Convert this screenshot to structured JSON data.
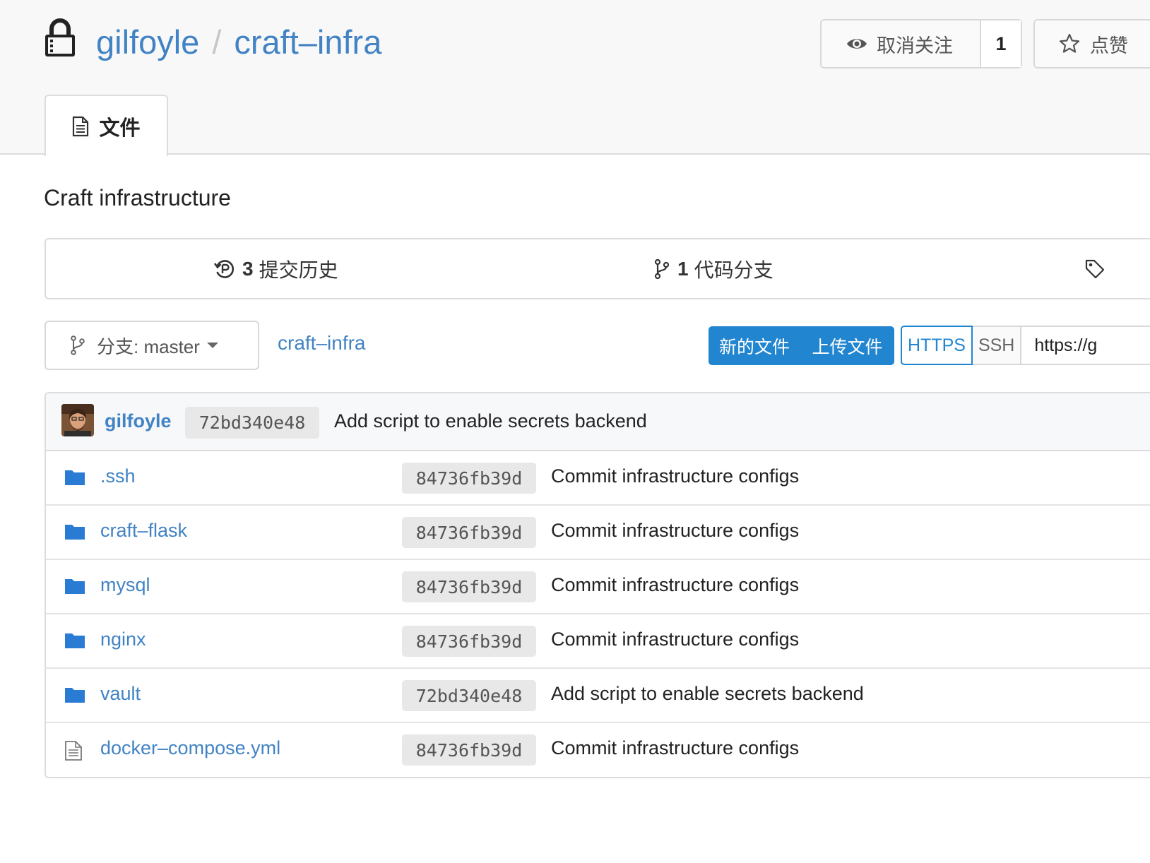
{
  "repo": {
    "owner": "gilfoyle",
    "separator": "/",
    "name": "craft–infra",
    "description": "Craft infrastructure"
  },
  "actions": {
    "watch_label": "取消关注",
    "watch_count": "1",
    "star_label": "点赞"
  },
  "tabs": [
    {
      "label": "文件"
    }
  ],
  "stats": {
    "commits_count": "3",
    "commits_label": "提交历史",
    "branches_count": "1",
    "branches_label": "代码分支"
  },
  "toolbar": {
    "branch_label": "分支: master",
    "path": "craft–infra",
    "new_file": "新的文件",
    "upload_file": "上传文件",
    "clone_https": "HTTPS",
    "clone_ssh": "SSH",
    "clone_url": "https://g"
  },
  "latest_commit": {
    "author": "gilfoyle",
    "sha": "72bd340e48",
    "message": "Add script to enable secrets backend"
  },
  "files": [
    {
      "name": ".ssh",
      "type": "folder",
      "sha": "84736fb39d",
      "message": "Commit infrastructure configs"
    },
    {
      "name": "craft–flask",
      "type": "folder",
      "sha": "84736fb39d",
      "message": "Commit infrastructure configs"
    },
    {
      "name": "mysql",
      "type": "folder",
      "sha": "84736fb39d",
      "message": "Commit infrastructure configs"
    },
    {
      "name": "nginx",
      "type": "folder",
      "sha": "84736fb39d",
      "message": "Commit infrastructure configs"
    },
    {
      "name": "vault",
      "type": "folder",
      "sha": "72bd340e48",
      "message": "Add script to enable secrets backend"
    },
    {
      "name": "docker–compose.yml",
      "type": "file",
      "sha": "84736fb39d",
      "message": "Commit infrastructure configs"
    }
  ],
  "colors": {
    "link": "#4183c4",
    "primary": "#2185d0",
    "folder": "#2a7bd3"
  }
}
